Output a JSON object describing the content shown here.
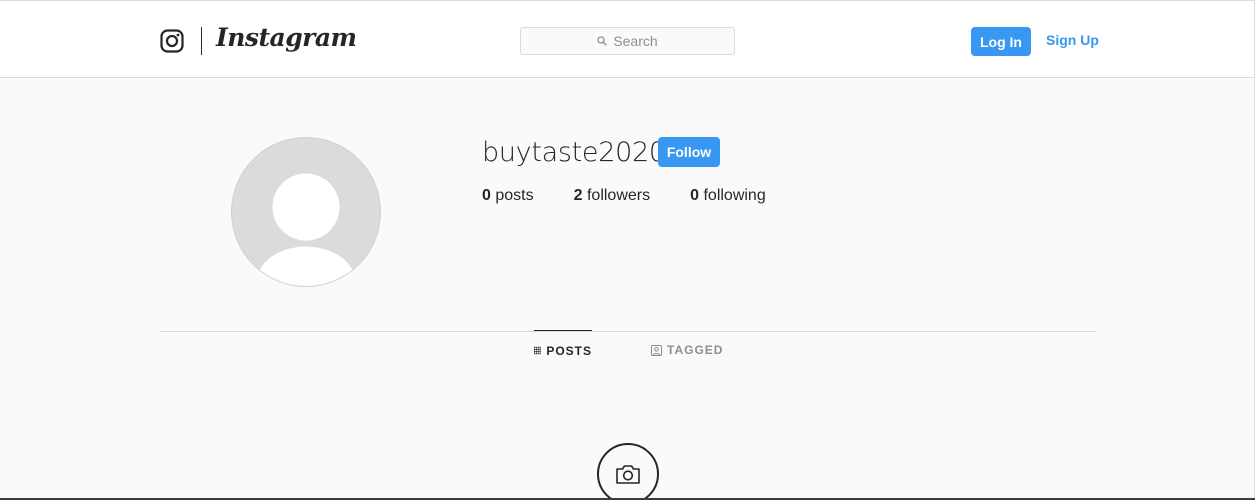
{
  "header": {
    "logo_text": "Instagram",
    "search_placeholder": "Search",
    "login_label": "Log In",
    "signup_label": "Sign Up"
  },
  "profile": {
    "username": "buytaste2020",
    "follow_label": "Follow",
    "stats": [
      {
        "value": "0",
        "label": "posts"
      },
      {
        "value": "2",
        "label": "followers"
      },
      {
        "value": "0",
        "label": "following"
      }
    ]
  },
  "tabs": [
    {
      "label": "POSTS",
      "icon": "grid-icon",
      "active": true
    },
    {
      "label": "TAGGED",
      "icon": "tagged-icon",
      "active": false
    }
  ],
  "empty_state": {
    "icon": "camera-icon"
  },
  "colors": {
    "accent": "#3897f0",
    "text": "#262626",
    "muted": "#8e8e8e",
    "border": "#dbdbdb",
    "background": "#fafafa"
  }
}
